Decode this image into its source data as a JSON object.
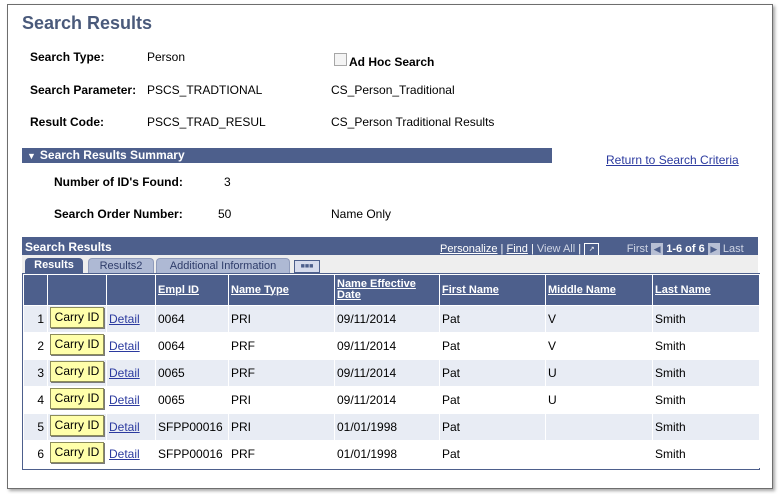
{
  "page": {
    "title": "Search Results"
  },
  "criteria": {
    "search_type_label": "Search Type:",
    "search_type_value": "Person",
    "ad_hoc_label": "Ad Hoc Search",
    "search_parameter_label": "Search Parameter:",
    "search_parameter_value": "PSCS_TRADTIONAL",
    "search_parameter_desc": "CS_Person_Traditional",
    "result_code_label": "Result Code:",
    "result_code_value": "PSCS_TRAD_RESUL",
    "result_code_desc": "CS_Person Traditional Results"
  },
  "summary": {
    "title": "Search Results Summary",
    "return_link": "Return to Search Criteria",
    "ids_found_label": "Number of ID's Found:",
    "ids_found_value": "3",
    "search_order_label": "Search Order Number:",
    "search_order_value": "50",
    "search_order_desc": "Name Only"
  },
  "grid": {
    "title": "Search Results",
    "personalize": "Personalize",
    "find": "Find",
    "view_all": "View All",
    "first": "First",
    "range": "1-6 of 6",
    "last": "Last",
    "tabs": [
      "Results",
      "Results2",
      "Additional Information"
    ],
    "columns": [
      "Empl ID",
      "Name Type",
      "Name Effective Date",
      "First Name",
      "Middle Name",
      "Last Name"
    ],
    "carry_label": "Carry ID",
    "detail_label": "Detail",
    "rows": [
      {
        "num": "1",
        "empl_id": "0064",
        "name_type": "PRI",
        "eff_date": "09/11/2014",
        "first": "Pat",
        "middle": "V",
        "last": "Smith"
      },
      {
        "num": "2",
        "empl_id": "0064",
        "name_type": "PRF",
        "eff_date": "09/11/2014",
        "first": "Pat",
        "middle": "V",
        "last": "Smith"
      },
      {
        "num": "3",
        "empl_id": "0065",
        "name_type": "PRF",
        "eff_date": "09/11/2014",
        "first": "Pat",
        "middle": "U",
        "last": "Smith"
      },
      {
        "num": "4",
        "empl_id": "0065",
        "name_type": "PRI",
        "eff_date": "09/11/2014",
        "first": "Pat",
        "middle": "U",
        "last": "Smith"
      },
      {
        "num": "5",
        "empl_id": "SFPP00016",
        "name_type": "PRI",
        "eff_date": "01/01/1998",
        "first": "Pat",
        "middle": "",
        "last": "Smith"
      },
      {
        "num": "6",
        "empl_id": "SFPP00016",
        "name_type": "PRF",
        "eff_date": "01/01/1998",
        "first": "Pat",
        "middle": "",
        "last": "Smith"
      }
    ]
  },
  "colors": {
    "header_blue": "#4d5f8c",
    "title_blue": "#4a5a7b",
    "button_yellow": "#ffffaa",
    "link_blue": "#2b3a9f"
  }
}
